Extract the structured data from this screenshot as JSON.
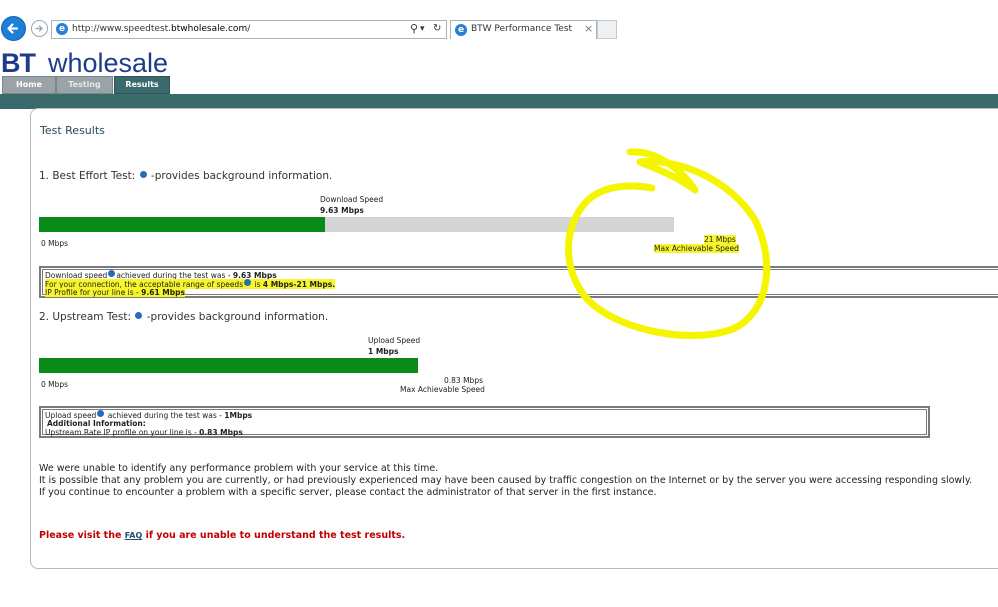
{
  "browser": {
    "url_prefix": "http://www.speedtest.",
    "url_domain": "btwholesale.com",
    "url_suffix": "/",
    "tab_title": "BTW Performance Test",
    "tab_close": "×",
    "search_glyph": "⚲",
    "dropdown_glyph": "▾",
    "refresh_glyph": "↻"
  },
  "header": {
    "logo_bt": "BT",
    "logo_word": "wholesale",
    "nav": [
      "Home",
      "Testing",
      "Results"
    ]
  },
  "results": {
    "title": "Test Results",
    "best_effort": {
      "heading": "1. Best Effort Test:",
      "help_text": "-provides background information.",
      "speed_label": "Download  Speed",
      "speed_value": "9.63 Mbps",
      "min_label": "0 Mbps",
      "max_value": "21 Mbps",
      "max_label": "Max Achievable Speed",
      "progress": 0.45,
      "line1_a": "Download speed",
      "line1_b": "achieved during the test was - ",
      "line1_value": "9.63 Mbps",
      "line2_a": "For your connection, the acceptable range of speeds",
      "line2_b": " is ",
      "line2_value": "4 Mbps-21 Mbps.",
      "line3_a": "IP Profile for your line is - ",
      "line3_value": "9.61 Mbps"
    },
    "upstream": {
      "heading": "2. Upstream Test:",
      "help_text": "-provides background information.",
      "speed_label": "Upload Speed",
      "speed_value": "1 Mbps",
      "min_label": "0 Mbps",
      "max_value": "0.83 Mbps",
      "max_label": "Max Achievable Speed",
      "progress": 1.0,
      "line1_a": "Upload speed",
      "line1_b": " achieved during the test was - ",
      "line1_value": "1Mbps",
      "line2": "Additional Information:",
      "line3_a": "Upstream Rate IP profile on your line is - ",
      "line3_value": "0.83 Mbps"
    },
    "message": [
      "We were unable to identify any performance problem with your service at this time.",
      "It is possible that any problem you are currently, or had previously experienced may have been caused by traffic congestion on the Internet or by the server you were accessing responding slowly.",
      "If you continue to encounter a problem with a specific server, please contact the administrator of that server in the first instance."
    ],
    "faq_before": "Please visit the ",
    "faq_link": "FAQ",
    "faq_after": " if you are unable to understand the test results."
  },
  "colors": {
    "progress_fill": "#0a8a16",
    "track": "#d4d4d4",
    "nav_bar": "#3b6a6c",
    "logo": "#1e3c8c",
    "highlight": "#f6f62a",
    "annotation": "#f5f500",
    "faq_text": "#c00000"
  },
  "icons": {
    "back": "back-arrow-icon",
    "forward": "forward-arrow-icon",
    "help": "help-icon",
    "browser": "ie-logo-icon"
  }
}
